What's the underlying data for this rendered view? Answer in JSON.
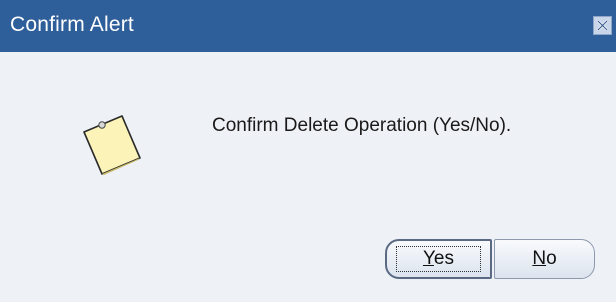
{
  "dialog": {
    "title": "Confirm Alert",
    "message": "Confirm Delete Operation (Yes/No).",
    "icon": "note-icon",
    "close_icon": "close-icon"
  },
  "buttons": {
    "yes": {
      "mnemonic": "Y",
      "rest": "es",
      "focused": true
    },
    "no": {
      "mnemonic": "N",
      "rest": "o",
      "focused": false
    }
  },
  "colors": {
    "titlebar": "#2f5f9a",
    "body": "#eef1f6",
    "note": "#fbf3b8"
  }
}
